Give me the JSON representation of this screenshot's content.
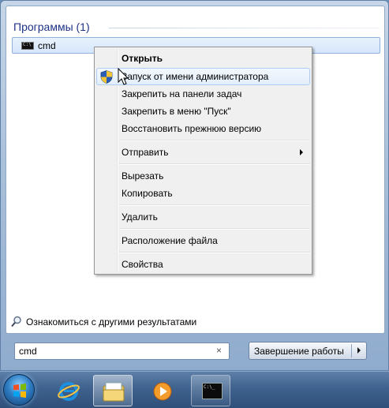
{
  "start_menu": {
    "programs_header": "Программы (1)",
    "results": [
      {
        "label": "cmd",
        "icon": "command-prompt-icon"
      }
    ],
    "see_more": "Ознакомиться с другими результатами",
    "search": {
      "value": "cmd",
      "clear_glyph": "×"
    },
    "shutdown_label": "Завершение работы"
  },
  "context_menu": {
    "items": [
      {
        "label": "Открыть",
        "bold": true
      },
      {
        "label": "Запуск от имени администратора",
        "icon": "uac-shield-icon",
        "highlighted": true
      },
      {
        "label": "Закрепить на панели задач"
      },
      {
        "label": "Закрепить в меню \"Пуск\""
      },
      {
        "label": "Восстановить прежнюю версию"
      },
      {
        "label": "Отправить",
        "submenu": true
      },
      {
        "label": "Вырезать"
      },
      {
        "label": "Копировать"
      },
      {
        "label": "Удалить"
      },
      {
        "label": "Расположение файла"
      },
      {
        "label": "Свойства"
      }
    ]
  },
  "taskbar": {
    "items": [
      {
        "name": "start-orb",
        "icon": "windows-orb-icon"
      },
      {
        "name": "internet-explorer",
        "icon": "internet-explorer-icon"
      },
      {
        "name": "windows-explorer",
        "icon": "folder-library-icon",
        "state": "active"
      },
      {
        "name": "media-player",
        "icon": "media-player-icon"
      },
      {
        "name": "command-prompt",
        "icon": "command-prompt-icon",
        "state": "open",
        "glyph": "C:\\_"
      }
    ]
  }
}
